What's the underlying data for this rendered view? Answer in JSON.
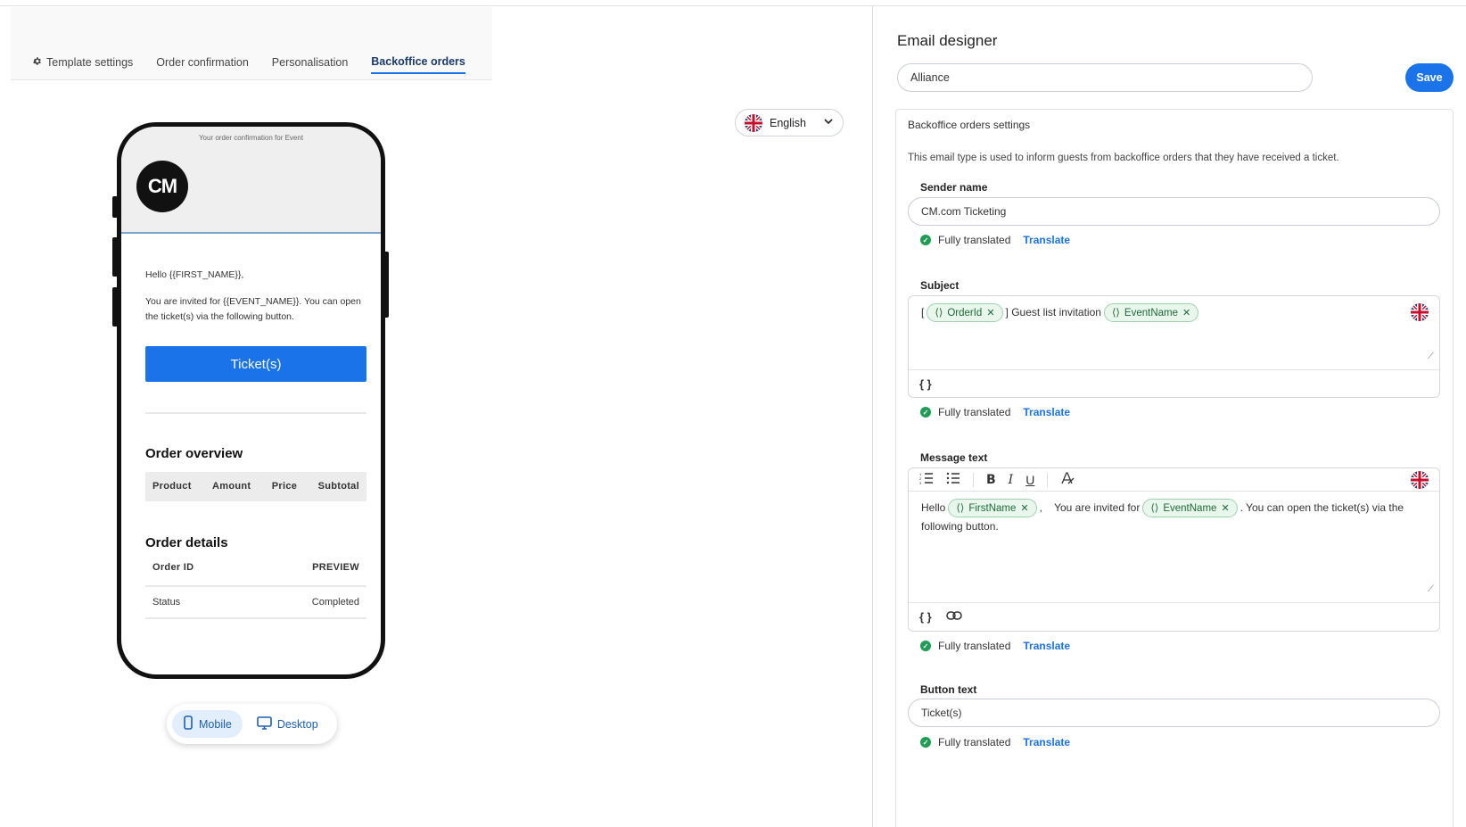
{
  "tabs": [
    {
      "label": "Template settings",
      "icon": "gear-icon"
    },
    {
      "label": "Order confirmation"
    },
    {
      "label": "Personalisation"
    },
    {
      "label": "Backoffice orders",
      "active": true
    }
  ],
  "language_selector": {
    "value": "English",
    "icon": "uk-flag-icon"
  },
  "preview": {
    "preheader": "Your order confirmation for Event",
    "logo_text": "CM",
    "greeting": "Hello {{FIRST_NAME}},",
    "intro": "You are invited for {{EVENT_NAME}}. You can open the ticket(s) via the following button.",
    "ticket_button": "Ticket(s)",
    "order_overview_title": "Order overview",
    "overview_columns": [
      "Product",
      "Amount",
      "Price",
      "Subtotal"
    ],
    "order_details_title": "Order details",
    "details": [
      {
        "label": "Order ID",
        "value": "PREVIEW"
      },
      {
        "label": "Status",
        "value": "Completed"
      }
    ]
  },
  "view_toggle": {
    "mobile": "Mobile",
    "desktop": "Desktop",
    "active": "mobile"
  },
  "designer": {
    "title": "Email designer",
    "template_name": "Alliance",
    "save_label": "Save",
    "section_title": "Backoffice orders settings",
    "section_desc": "This email type is used to inform guests from backoffice orders that they have received a ticket.",
    "sender": {
      "label": "Sender name",
      "value": "CM.com Ticketing"
    },
    "subject": {
      "label": "Subject",
      "prefix": "[",
      "chip1": "OrderId",
      "middle": "] Guest list invitation",
      "chip2": "EventName",
      "foot_icon": "{ }"
    },
    "message": {
      "label": "Message text",
      "hello": "Hello",
      "chip1": "FirstName",
      "comma": ",",
      "mid": "You are invited for",
      "chip2": "EventName",
      "tail": ". You can open the ticket(s) via the",
      "tail2": "following button.",
      "foot_icon": "{ }"
    },
    "button_text": {
      "label": "Button text",
      "value": "Ticket(s)"
    },
    "translated_label": "Fully translated",
    "translate_link": "Translate"
  },
  "colors": {
    "accent": "#1a73e8",
    "success": "#1f9d55",
    "chip_bg": "#e8f6ec"
  }
}
